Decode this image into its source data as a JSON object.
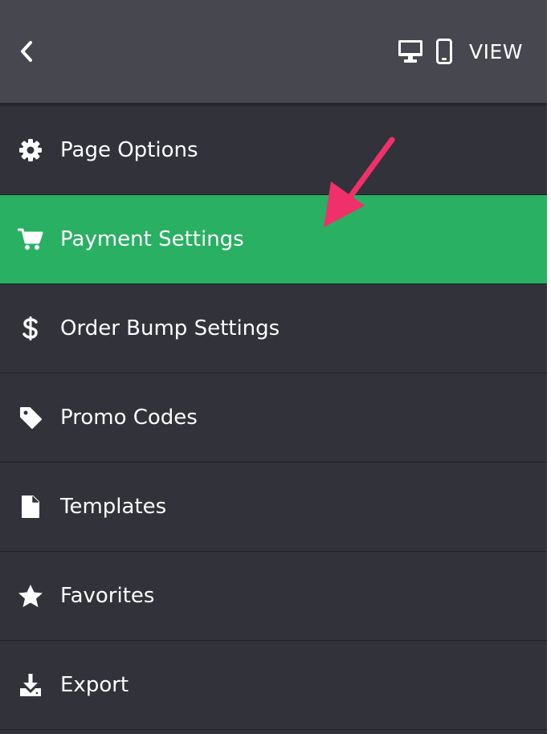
{
  "header": {
    "back_icon": "chevron-left-icon",
    "desktop_icon": "desktop-icon",
    "mobile_icon": "mobile-icon",
    "view_label": "VIEW"
  },
  "menu": {
    "items": [
      {
        "label": "Page Options",
        "icon": "gear-icon",
        "active": false
      },
      {
        "label": "Payment Settings",
        "icon": "shopping-cart-icon",
        "active": true
      },
      {
        "label": "Order Bump Settings",
        "icon": "dollar-icon",
        "active": false
      },
      {
        "label": "Promo Codes",
        "icon": "tag-icon",
        "active": false
      },
      {
        "label": "Templates",
        "icon": "file-icon",
        "active": false
      },
      {
        "label": "Favorites",
        "icon": "star-icon",
        "active": false
      },
      {
        "label": "Export",
        "icon": "download-icon",
        "active": false
      }
    ]
  },
  "annotation": {
    "type": "arrow",
    "color": "#f0306a",
    "points_to": "Payment Settings"
  },
  "colors": {
    "panel_bg": "#32333a",
    "header_bg": "#47484f",
    "active_bg": "#29b062",
    "text": "#ffffff"
  }
}
